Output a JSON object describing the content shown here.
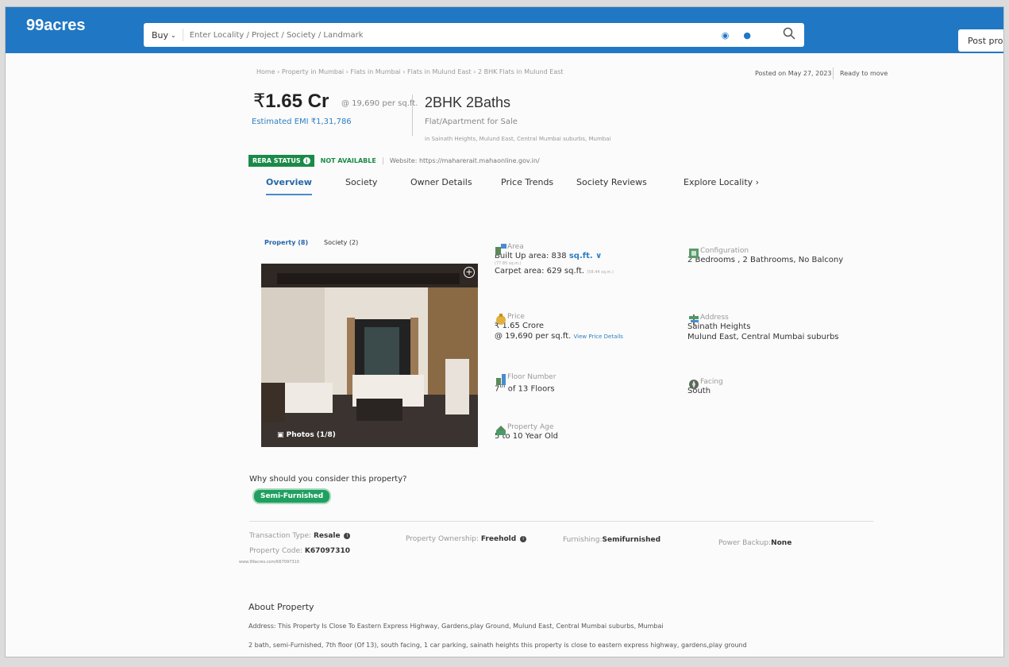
{
  "header": {
    "logo": "99acres",
    "buy_label": "Buy",
    "search_placeholder": "Enter Locality / Project / Society / Landmark",
    "post_label": "Post prop"
  },
  "breadcrumb": "Home › Property in Mumbai › Flats in Mumbai › Flats in Mulund East › 2 BHK Flats in Mulund East",
  "posted_on": "Posted on May 27, 2023",
  "status": "Ready to move",
  "price": {
    "symbol": "₹",
    "amount": "1.65 Cr",
    "per_sqft": "@ 19,690 per sq.ft.",
    "emi": "Estimated EMI ₹1,31,786"
  },
  "property": {
    "title": "2BHK 2Baths",
    "subtitle": "Flat/Apartment for Sale",
    "location": "in Sainath Heights, Mulund East, Central Mumbai suburbs, Mumbai"
  },
  "rera": {
    "badge": "RERA STATUS",
    "value": "NOT AVAILABLE",
    "website": "Website: https://maharerait.mahaonline.gov.in/"
  },
  "tabs": [
    "Overview",
    "Society",
    "Owner Details",
    "Price Trends",
    "Society Reviews",
    "Explore Locality ›"
  ],
  "subtabs": [
    "Property (8)",
    "Society (2)"
  ],
  "photo_label": "Photos (1/8)",
  "details": {
    "area": {
      "label": "Area",
      "built_up": "Built Up area: 838",
      "unit": "sq.ft. ∨",
      "built_small": "(77.85 sq.m.)",
      "carpet": "Carpet area: 629 sq.ft.",
      "carpet_small": "(58.44 sq.m.)"
    },
    "configuration": {
      "label": "Configuration",
      "value": "2 Bedrooms , 2 Bathrooms, No Balcony"
    },
    "price": {
      "label": "Price",
      "value": "₹ 1.65 Crore",
      "per_sqft": "@ 19,690 per sq.ft.",
      "link": "View Price Details"
    },
    "address": {
      "label": "Address",
      "line1": "Sainath Heights",
      "line2": "Mulund East, Central Mumbai suburbs"
    },
    "floor": {
      "label": "Floor Number",
      "num": "7",
      "sup": "th",
      "rest": " of 13 Floors"
    },
    "facing": {
      "label": "Facing",
      "value": "South"
    },
    "age": {
      "label": "Property Age",
      "value": "5 to 10 Year Old"
    }
  },
  "why_heading": "Why should you consider this property?",
  "why_badge": "Semi-Furnished",
  "transaction": {
    "type_label": "Transaction Type:",
    "type_value": "Resale",
    "ownership_label": "Property Ownership:",
    "ownership_value": "Freehold",
    "furnishing_label": "Furnishing:",
    "furnishing_value": "Semifurnished",
    "power_label": "Power Backup:",
    "power_value": "None",
    "code_label": "Property Code:",
    "code_value": "K67097310",
    "code_url": "www.99acres.com/K67097310"
  },
  "about": {
    "heading": "About Property",
    "line1": "Address: This Property Is Close To Eastern Express Highway, Gardens,play Ground, Mulund East, Central Mumbai suburbs, Mumbai",
    "line2": "2 bath, semi-Furnished, 7th floor (Of 13), south facing, 1 car parking, sainath heights this property is close to eastern express highway, gardens,play ground"
  },
  "colors": {
    "header_blue": "#2078c4",
    "rera_green": "#1b8a49",
    "link_blue": "#2e7fc2",
    "badge_green": "#1fa060"
  }
}
